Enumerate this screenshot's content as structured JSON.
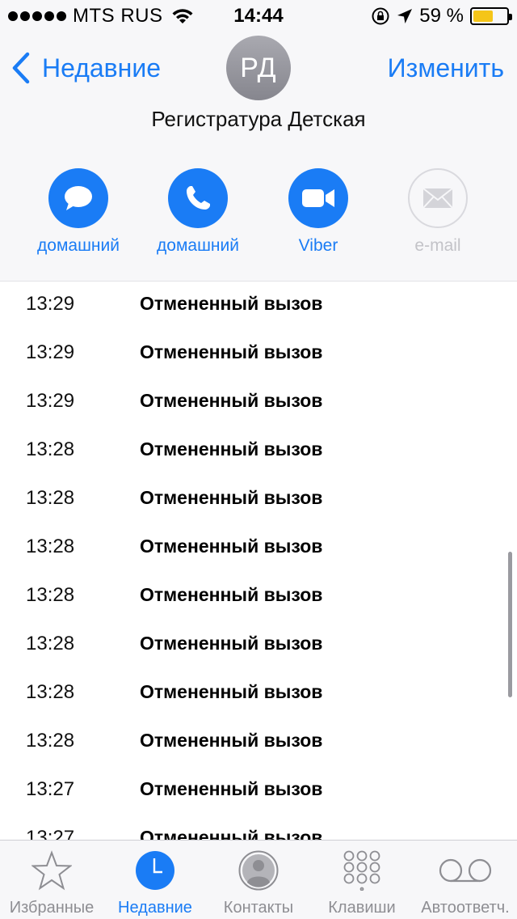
{
  "status_bar": {
    "carrier": "MTS RUS",
    "time": "14:44",
    "battery_percent": "59 %",
    "battery_level": 0.59
  },
  "header": {
    "back_label": "Недавние",
    "edit_label": "Изменить",
    "avatar_initials": "РД",
    "contact_name": "Регистратура Детская"
  },
  "actions": [
    {
      "label": "домашний",
      "icon": "message-icon",
      "enabled": true
    },
    {
      "label": "домашний",
      "icon": "phone-icon",
      "enabled": true
    },
    {
      "label": "Viber",
      "icon": "video-icon",
      "enabled": true
    },
    {
      "label": "e-mail",
      "icon": "mail-icon",
      "enabled": false
    }
  ],
  "calls": [
    {
      "time": "13:29",
      "status": "Отмененный вызов"
    },
    {
      "time": "13:29",
      "status": "Отмененный вызов"
    },
    {
      "time": "13:29",
      "status": "Отмененный вызов"
    },
    {
      "time": "13:28",
      "status": "Отмененный вызов"
    },
    {
      "time": "13:28",
      "status": "Отмененный вызов"
    },
    {
      "time": "13:28",
      "status": "Отмененный вызов"
    },
    {
      "time": "13:28",
      "status": "Отмененный вызов"
    },
    {
      "time": "13:28",
      "status": "Отмененный вызов"
    },
    {
      "time": "13:28",
      "status": "Отмененный вызов"
    },
    {
      "time": "13:28",
      "status": "Отмененный вызов"
    },
    {
      "time": "13:27",
      "status": "Отмененный вызов"
    },
    {
      "time": "13:27",
      "status": "Отмененный вызов"
    }
  ],
  "tabs": [
    {
      "label": "Избранные",
      "icon": "star-icon",
      "active": false
    },
    {
      "label": "Недавние",
      "icon": "clock-icon",
      "active": true
    },
    {
      "label": "Контакты",
      "icon": "contacts-icon",
      "active": false
    },
    {
      "label": "Клавиши",
      "icon": "keypad-icon",
      "active": false
    },
    {
      "label": "Автоответч.",
      "icon": "voicemail-icon",
      "active": false
    }
  ],
  "colors": {
    "accent": "#1a7cf5",
    "inactive": "#8e8e93",
    "disabled": "#c3c3c8",
    "battery": "#f5c518"
  }
}
